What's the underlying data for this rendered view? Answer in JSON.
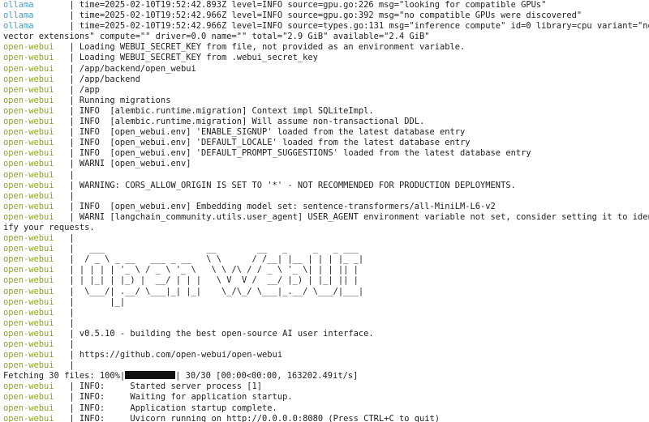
{
  "terminal": {
    "lines": [
      {
        "prefix": "ollama      ",
        "kind": "ollama",
        "text": " | time=2025-02-10T19:52:42.893Z level=INFO source=gpu.go:226 msg=\"looking for compatible GPUs\""
      },
      {
        "prefix": "ollama      ",
        "kind": "ollama",
        "text": " | time=2025-02-10T19:52:42.966Z level=INFO source=gpu.go:392 msg=\"no compatible GPUs were discovered\""
      },
      {
        "prefix": "ollama      ",
        "kind": "ollama",
        "text": " | time=2025-02-10T19:52:42.966Z level=INFO source=types.go:131 msg=\"inference compute\" id=0 library=cpu variant=\"no"
      },
      {
        "prefix": "",
        "kind": "plain",
        "text": "vector extensions\" compute=\"\" driver=0.0 name=\"\" total=\"2.9 GiB\" available=\"2.4 GiB\""
      },
      {
        "prefix": "open-webui  ",
        "kind": "webui",
        "text": " | Loading WEBUI_SECRET_KEY from file, not provided as an environment variable."
      },
      {
        "prefix": "open-webui  ",
        "kind": "webui",
        "text": " | Loading WEBUI_SECRET_KEY from .webui_secret_key"
      },
      {
        "prefix": "open-webui  ",
        "kind": "webui",
        "text": " | /app/backend/open_webui"
      },
      {
        "prefix": "open-webui  ",
        "kind": "webui",
        "text": " | /app/backend"
      },
      {
        "prefix": "open-webui  ",
        "kind": "webui",
        "text": " | /app"
      },
      {
        "prefix": "open-webui  ",
        "kind": "webui",
        "text": " | Running migrations"
      },
      {
        "prefix": "open-webui  ",
        "kind": "webui",
        "text": " | INFO  [alembic.runtime.migration] Context impl SQLiteImpl."
      },
      {
        "prefix": "open-webui  ",
        "kind": "webui",
        "text": " | INFO  [alembic.runtime.migration] Will assume non-transactional DDL."
      },
      {
        "prefix": "open-webui  ",
        "kind": "webui",
        "text": " | INFO  [open_webui.env] 'ENABLE_SIGNUP' loaded from the latest database entry"
      },
      {
        "prefix": "open-webui  ",
        "kind": "webui",
        "text": " | INFO  [open_webui.env] 'DEFAULT_LOCALE' loaded from the latest database entry"
      },
      {
        "prefix": "open-webui  ",
        "kind": "webui",
        "text": " | INFO  [open_webui.env] 'DEFAULT_PROMPT_SUGGESTIONS' loaded from the latest database entry"
      },
      {
        "prefix": "open-webui  ",
        "kind": "webui",
        "text": " | WARNI [open_webui.env]"
      },
      {
        "prefix": "open-webui  ",
        "kind": "webui",
        "text": " |"
      },
      {
        "prefix": "open-webui  ",
        "kind": "webui",
        "text": " | WARNING: CORS_ALLOW_ORIGIN IS SET TO '*' - NOT RECOMMENDED FOR PRODUCTION DEPLOYMENTS."
      },
      {
        "prefix": "open-webui  ",
        "kind": "webui",
        "text": " |"
      },
      {
        "prefix": "open-webui  ",
        "kind": "webui",
        "text": " | INFO  [open_webui.env] Embedding model set: sentence-transformers/all-MiniLM-L6-v2"
      },
      {
        "prefix": "open-webui  ",
        "kind": "webui",
        "text": " | WARNI [langchain_community.utils.user_agent] USER_AGENT environment variable not set, consider setting it to ident"
      },
      {
        "prefix": "",
        "kind": "plain",
        "text": "ify your requests."
      },
      {
        "prefix": "open-webui  ",
        "kind": "webui",
        "text": " |"
      },
      {
        "prefix": "open-webui  ",
        "kind": "webui",
        "text": " |   ___                    __        __   _     _   _ ___ "
      },
      {
        "prefix": "open-webui  ",
        "kind": "webui",
        "text": " |  / _ \\ _ __   ___ _ __   \\ \\      / /__| |__ | | | |_ _|"
      },
      {
        "prefix": "open-webui  ",
        "kind": "webui",
        "text": " | | | | | '_ \\ / _ \\ '_ \\   \\ \\ /\\ / / _ \\ '_ \\| | | || | "
      },
      {
        "prefix": "open-webui  ",
        "kind": "webui",
        "text": " | | |_| | |_) |  __/ | | |   \\ V  V /  __/ |_) | |_| || | "
      },
      {
        "prefix": "open-webui  ",
        "kind": "webui",
        "text": " |  \\___/| .__/ \\___|_| |_|    \\_/\\_/ \\___|_.__/ \\___/|___|"
      },
      {
        "prefix": "open-webui  ",
        "kind": "webui",
        "text": " |       |_|"
      },
      {
        "prefix": "open-webui  ",
        "kind": "webui",
        "text": " |"
      },
      {
        "prefix": "open-webui  ",
        "kind": "webui",
        "text": " |"
      },
      {
        "prefix": "open-webui  ",
        "kind": "webui",
        "text": " | v0.5.10 - building the best open-source AI user interface."
      },
      {
        "prefix": "open-webui  ",
        "kind": "webui",
        "text": " |"
      },
      {
        "prefix": "open-webui  ",
        "kind": "webui",
        "text": " | https://github.com/open-webui/open-webui"
      },
      {
        "prefix": "open-webui  ",
        "kind": "webui",
        "text": " |"
      }
    ],
    "progress": {
      "text_before": "Fetching 30 files: 100%|",
      "text_after": "| 30/30 [00:00<00:00, 163202.49it/s]",
      "fraction": 1.0
    },
    "tail_lines": [
      {
        "prefix": "open-webui  ",
        "kind": "webui",
        "text": " | INFO:     Started server process [1]"
      },
      {
        "prefix": "open-webui  ",
        "kind": "webui",
        "text": " | INFO:     Waiting for application startup."
      },
      {
        "prefix": "open-webui  ",
        "kind": "webui",
        "text": " | INFO:     Application startup complete."
      },
      {
        "prefix": "open-webui  ",
        "kind": "webui",
        "text": " | INFO:     Uvicorn running on http://0.0.0.0:8080 (Press CTRL+C to quit)"
      }
    ],
    "colors": {
      "ollama_prefix": "#4aa0c2",
      "webui_prefix": "#8aa624",
      "text": "#1e1e1e",
      "background": "#ffffff"
    }
  }
}
